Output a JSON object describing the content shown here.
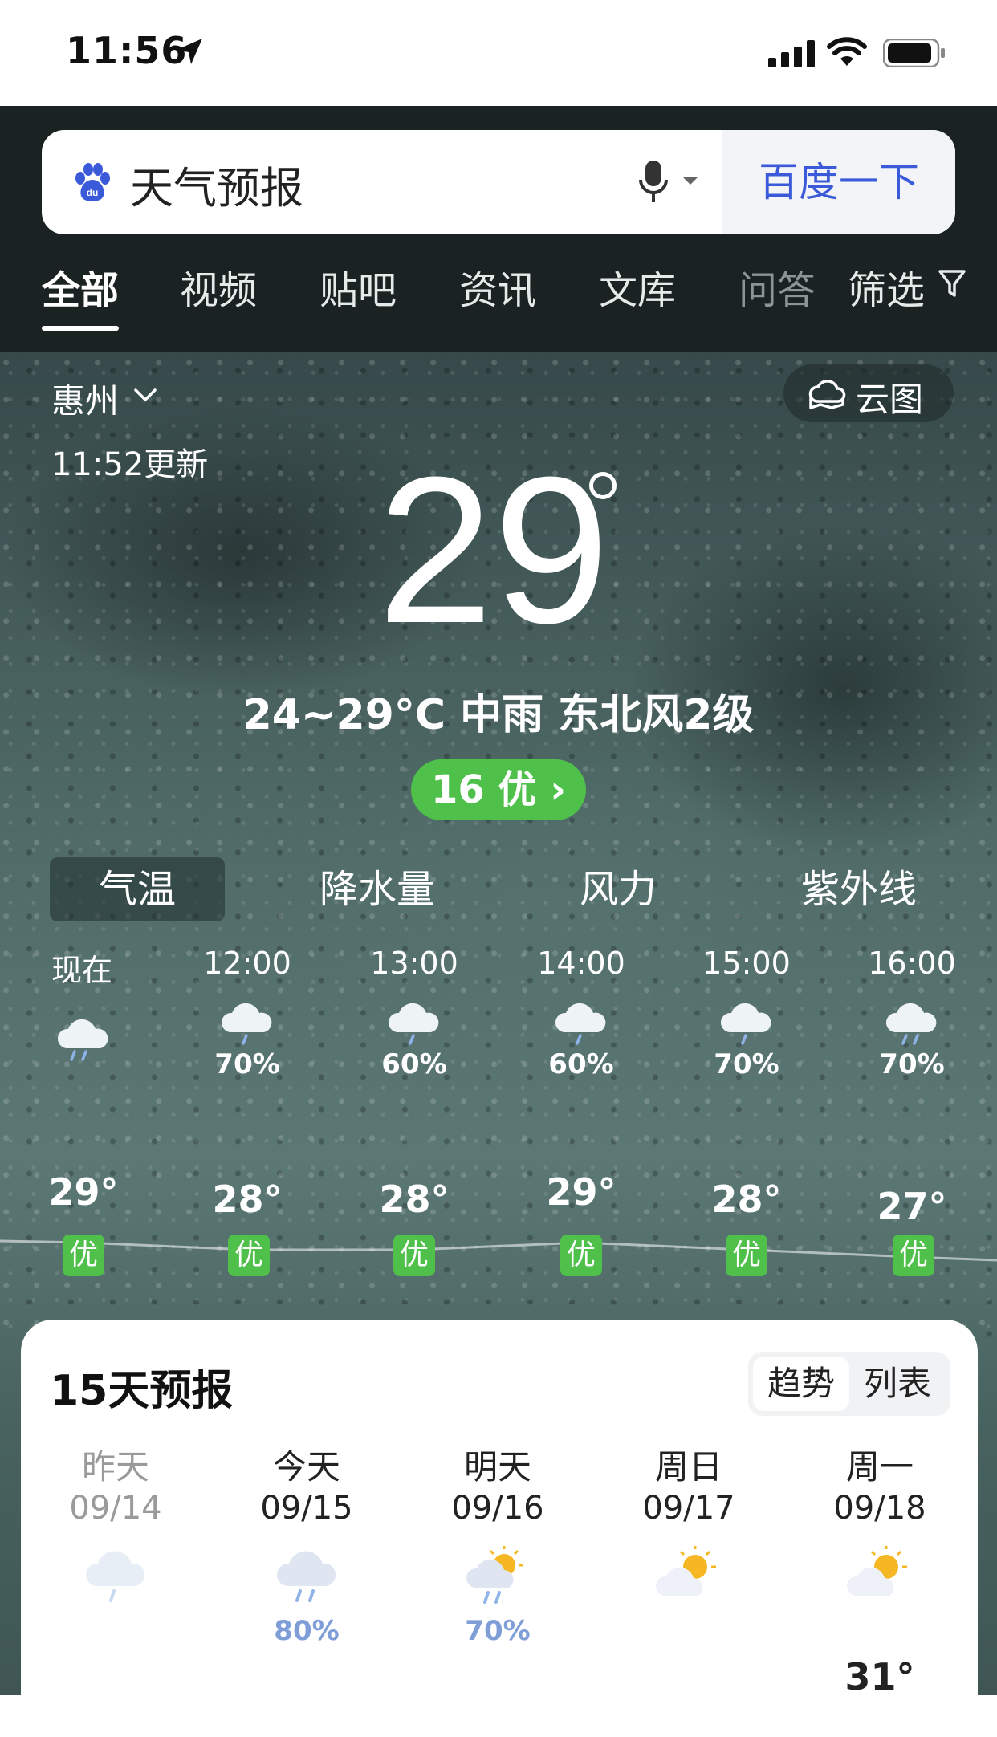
{
  "status_bar": {
    "time": "11:56",
    "icons": [
      "location-arrow-icon",
      "signal-icon",
      "wifi-icon",
      "battery-icon"
    ]
  },
  "search": {
    "query": "天气预报",
    "button_label": "百度一下",
    "accent_color": "#3a5ad9"
  },
  "tabs": [
    {
      "label": "全部",
      "active": true
    },
    {
      "label": "视频"
    },
    {
      "label": "贴吧"
    },
    {
      "label": "资讯"
    },
    {
      "label": "文库"
    },
    {
      "label": "问答"
    },
    {
      "label": "筛选"
    }
  ],
  "weather": {
    "city": "惠州",
    "cloud_map_label": "云图",
    "updated": "11:52更新",
    "current_temp": "29",
    "condition": "24~29°C 中雨 东北风2级",
    "aqi_label": "16 优 ›",
    "aqi_color": "#4fc04a",
    "metric_tabs": [
      "气温",
      "降水量",
      "风力",
      "紫外线"
    ],
    "active_metric": "气温",
    "hourly": [
      {
        "time": "现在",
        "prob": "",
        "temp": "29°",
        "temp_value": 29,
        "aqi": "优"
      },
      {
        "time": "12:00",
        "prob": "70%",
        "temp": "28°",
        "temp_value": 28,
        "aqi": "优"
      },
      {
        "time": "13:00",
        "prob": "60%",
        "temp": "28°",
        "temp_value": 28,
        "aqi": "优"
      },
      {
        "time": "14:00",
        "prob": "60%",
        "temp": "29°",
        "temp_value": 29,
        "aqi": "优"
      },
      {
        "time": "15:00",
        "prob": "70%",
        "temp": "28°",
        "temp_value": 28,
        "aqi": "优"
      },
      {
        "time": "16:00",
        "prob": "70%",
        "temp": "27°",
        "temp_value": 27,
        "aqi": "优"
      }
    ]
  },
  "forecast": {
    "title": "15天预报",
    "view_options": [
      "趋势",
      "列表"
    ],
    "active_view": "趋势",
    "days": [
      {
        "name": "昨天",
        "date": "09/14",
        "icon": "rain-cloud-icon",
        "prob": "",
        "high": "",
        "past": true
      },
      {
        "name": "今天",
        "date": "09/15",
        "icon": "rain-cloud-icon",
        "prob": "80%",
        "high": ""
      },
      {
        "name": "明天",
        "date": "09/16",
        "icon": "sun-rain-icon",
        "prob": "70%",
        "high": ""
      },
      {
        "name": "周日",
        "date": "09/17",
        "icon": "sun-cloud-icon",
        "prob": "",
        "high": ""
      },
      {
        "name": "周一",
        "date": "09/18",
        "icon": "sun-cloud-icon",
        "prob": "",
        "high": "31°"
      }
    ]
  }
}
